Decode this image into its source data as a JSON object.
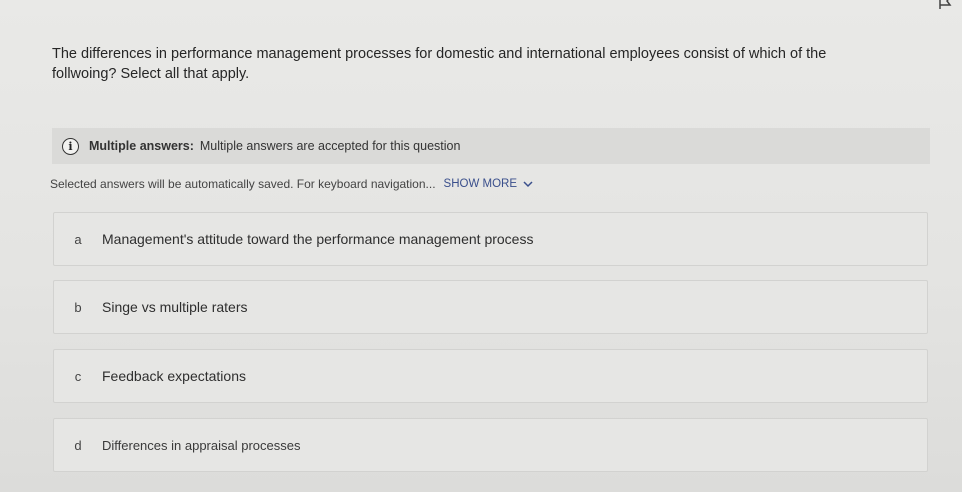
{
  "question": {
    "text": "The differences in performance management processes for domestic and international employees consist of which of the follwoing? Select all that apply."
  },
  "info_bar": {
    "icon": "info-icon",
    "label": "Multiple answers:",
    "text": "Multiple answers are accepted for this question"
  },
  "instructions": {
    "text": "Selected answers will be automatically saved. For keyboard navigation...",
    "show_more": "SHOW MORE"
  },
  "options": [
    {
      "letter": "a",
      "text": "Management's attitude toward the performance management process"
    },
    {
      "letter": "b",
      "text": "Singe vs multiple raters"
    },
    {
      "letter": "c",
      "text": "Feedback expectations"
    },
    {
      "letter": "d",
      "text": "Differences in appraisal processes"
    }
  ]
}
